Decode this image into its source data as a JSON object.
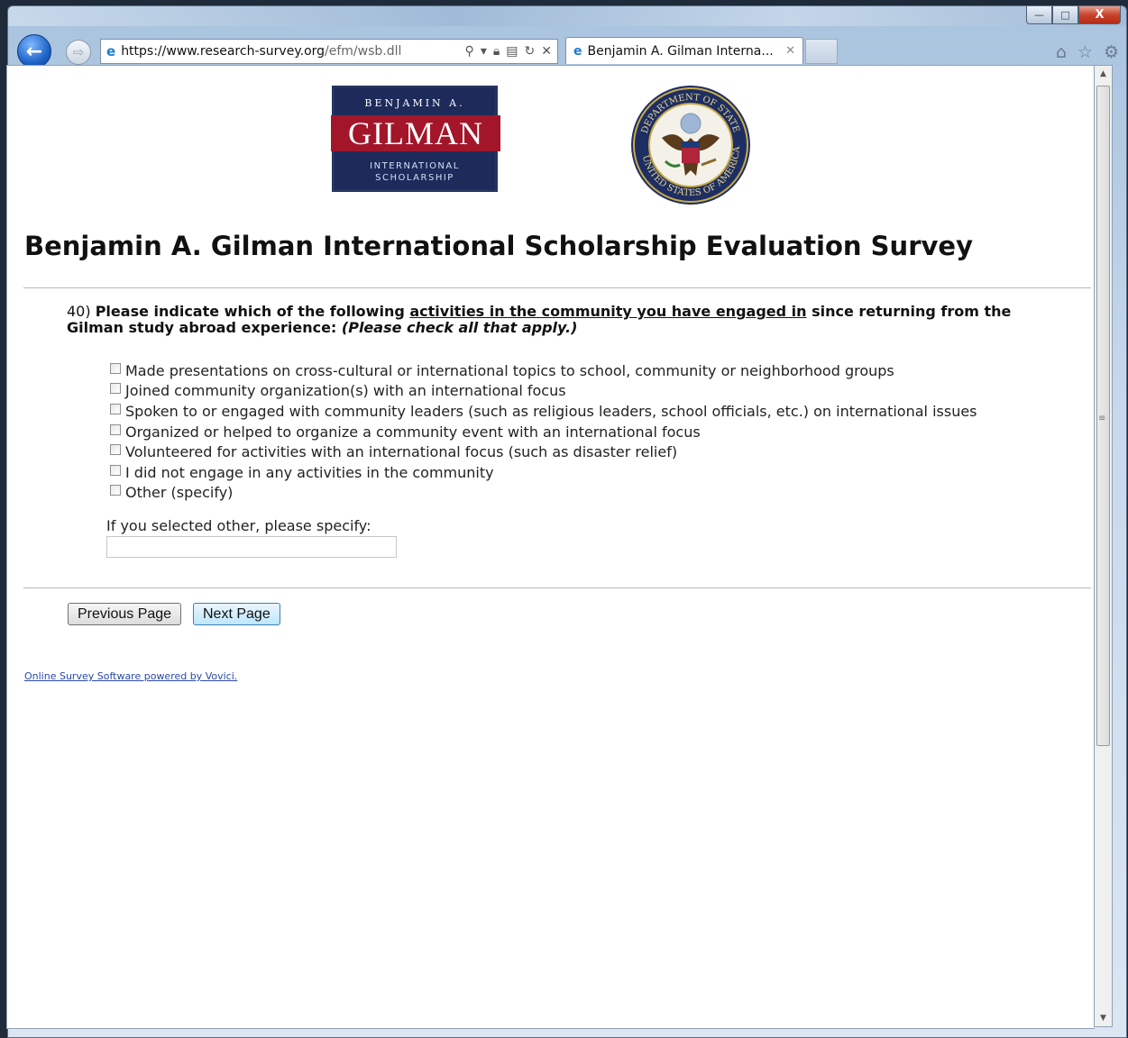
{
  "browser": {
    "address": {
      "host": "https://www.research-survey.org",
      "path": "/efm/wsb.dll"
    },
    "tab_title": "Benjamin A. Gilman Interna...",
    "caption": {
      "minimize": "—",
      "maximize": "□",
      "close": "X"
    }
  },
  "logos": {
    "gilman_top": "BENJAMIN A.",
    "gilman_mid": "GILMAN",
    "gilman_bot1": "INTERNATIONAL",
    "gilman_bot2": "SCHOLARSHIP",
    "seal_top": "DEPARTMENT OF STATE",
    "seal_bottom": "UNITED STATES OF AMERICA"
  },
  "page": {
    "title": "Benjamin A. Gilman International Scholarship Evaluation Survey"
  },
  "question": {
    "number": "40)",
    "text_before": "Please indicate which of the following",
    "text_underlined": "activities in the community you have engaged in",
    "text_after": "since returning from the Gilman study abroad experience:",
    "instruction": "(Please check all that apply.)",
    "options": [
      {
        "label": "Made presentations on cross-cultural or international topics to school, community or neighborhood groups",
        "checked": false
      },
      {
        "label": "Joined community organization(s) with an international focus",
        "checked": false
      },
      {
        "label": "Spoken to or engaged with community leaders (such as religious leaders, school officials, etc.) on international issues",
        "checked": false
      },
      {
        "label": "Organized or helped to organize a community event with an international focus",
        "checked": false
      },
      {
        "label": "Volunteered for activities with an international focus (such as disaster relief)",
        "checked": false
      },
      {
        "label": "I did not engage in any activities in the community",
        "checked": false
      },
      {
        "label": "Other (specify)",
        "checked": false
      }
    ],
    "specify_label": "If you selected other, please specify:",
    "specify_value": ""
  },
  "buttons": {
    "previous": "Previous Page",
    "next": "Next Page"
  },
  "footer": "Online Survey Software powered by Vovici."
}
